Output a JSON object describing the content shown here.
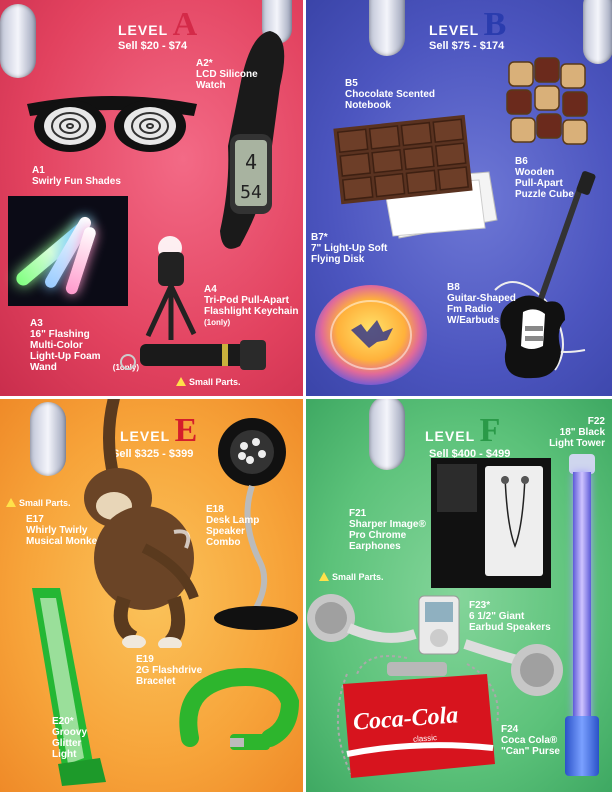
{
  "colors": {
    "level_a_letter": "#d42a48",
    "level_b_letter": "#2a3cae",
    "level_e_letter": "#d41e2b",
    "level_f_letter": "#2a9a48"
  },
  "level_a": {
    "word": "LEVEL",
    "letter": "A",
    "price": "Sell $20 - $74",
    "items": [
      {
        "code": "A1",
        "name": "Swirly Fun Shades"
      },
      {
        "code": "A2*",
        "name": "LCD Silicone Watch"
      },
      {
        "code": "A3",
        "name": "16\" Flashing Multi-Color Light-Up Foam Wand",
        "note": "(1only)"
      },
      {
        "code": "A4",
        "name": "Tri-Pod Pull-Apart Flashlight Keychain",
        "note": "(1only)"
      }
    ],
    "warning": "Small Parts.",
    "watch_display_top": "4",
    "watch_display_bottom": "54"
  },
  "level_b": {
    "word": "LEVEL",
    "letter": "B",
    "price": "Sell $75 - $174",
    "items": [
      {
        "code": "B5",
        "name": "Chocolate Scented Notebook"
      },
      {
        "code": "B6",
        "name": "Wooden Pull-Apart Puzzle Cube"
      },
      {
        "code": "B7*",
        "name": "7\" Light-Up Soft Flying Disk"
      },
      {
        "code": "B8",
        "name": "Guitar-Shaped Fm Radio W/Earbuds"
      }
    ]
  },
  "level_e": {
    "word": "LEVEL",
    "letter": "E",
    "price": "Sell $325 - $399",
    "items": [
      {
        "code": "E17",
        "name": "Whirly Twirly Musical Monkey"
      },
      {
        "code": "E18",
        "name": "Desk Lamp Speaker Combo"
      },
      {
        "code": "E19",
        "name": "2G Flashdrive Bracelet"
      },
      {
        "code": "E20*",
        "name": "Groovy Glitter Light"
      }
    ],
    "warning": "Small Parts."
  },
  "level_f": {
    "word": "LEVEL",
    "letter": "F",
    "price": "Sell $400 - $499",
    "items": [
      {
        "code": "F21",
        "name": "Sharper Image® Pro Chrome Earphones"
      },
      {
        "code": "F22",
        "name": "18\" Black Light Tower"
      },
      {
        "code": "F23*",
        "name": "6 1/2\" Giant Earbud Speakers"
      },
      {
        "code": "F24",
        "name": "Coca Cola® \"Can\" Purse"
      }
    ],
    "warning": "Small Parts.",
    "purse_logo": "Coca-Cola",
    "purse_sub": "classic"
  }
}
